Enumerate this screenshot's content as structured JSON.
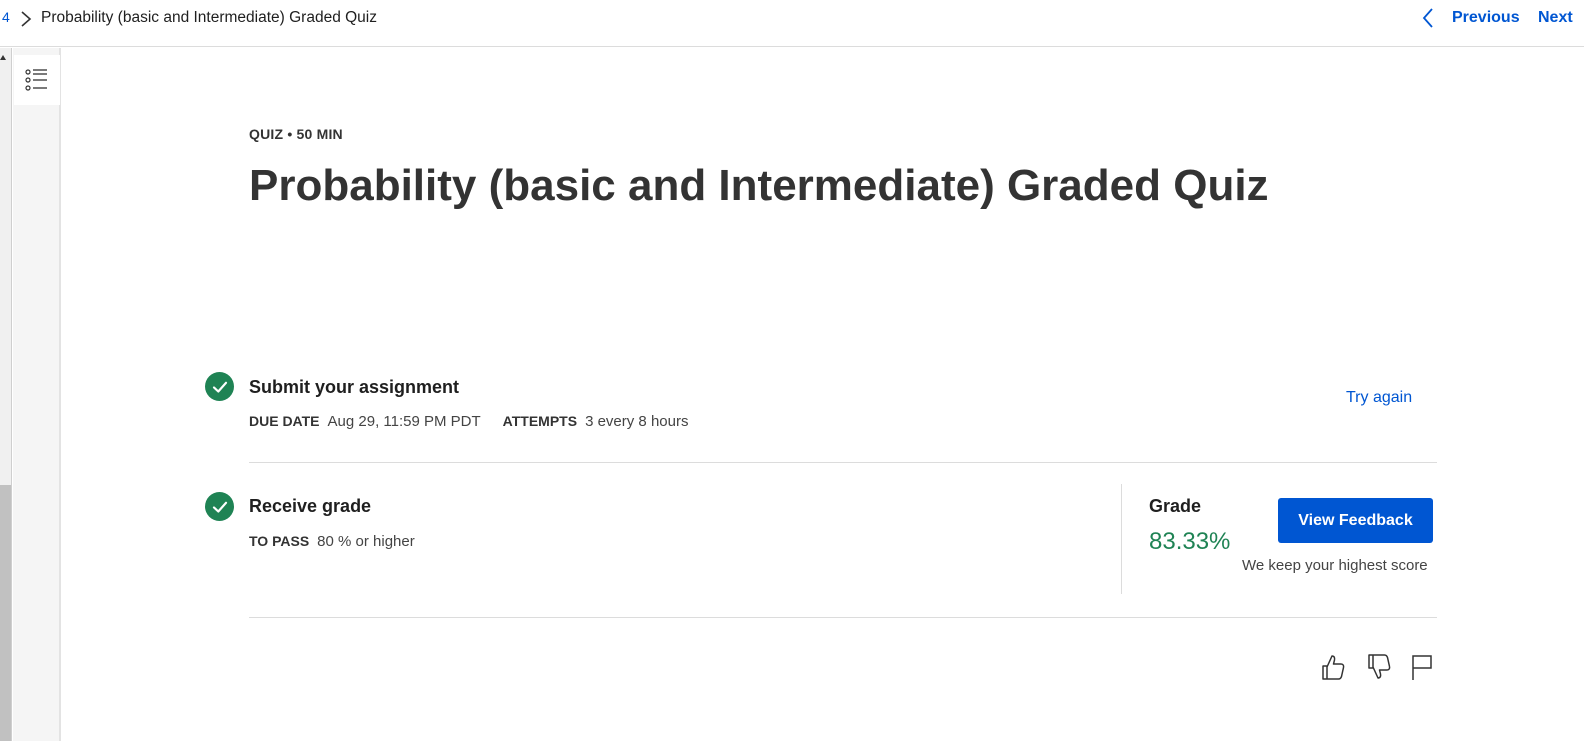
{
  "breadcrumb": {
    "step_number": "4",
    "current": "Probability (basic and Intermediate) Graded Quiz"
  },
  "nav": {
    "previous_label": "Previous",
    "next_label": "Next"
  },
  "quiz": {
    "eyebrow": "QUIZ • 50 MIN",
    "title": "Probability (basic and Intermediate) Graded Quiz"
  },
  "submit": {
    "title": "Submit your assignment",
    "due_label": "DUE DATE",
    "due_value": "Aug 29, 11:59 PM PDT",
    "attempts_label": "ATTEMPTS",
    "attempts_value": "3 every 8 hours",
    "try_again_label": "Try again"
  },
  "receive": {
    "title": "Receive grade",
    "pass_label": "TO PASS",
    "pass_value": "80 % or higher"
  },
  "grade": {
    "label": "Grade",
    "value": "83.33%",
    "feedback_button": "View Feedback",
    "note": "We keep your highest score"
  },
  "icons": [
    "chevron-right-icon",
    "chevron-left-icon",
    "list-icon",
    "check-icon",
    "thumbs-up-icon",
    "thumbs-down-icon",
    "flag-icon"
  ],
  "colors": {
    "accent": "#0056d2",
    "success": "#1f8354"
  }
}
